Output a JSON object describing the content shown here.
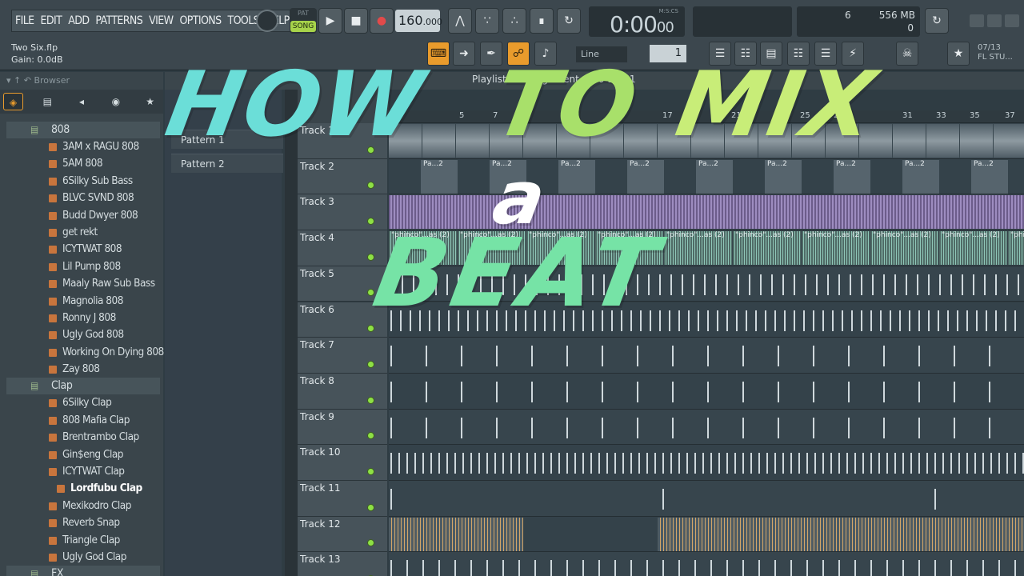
{
  "menu": [
    "FILE",
    "EDIT",
    "ADD",
    "PATTERNS",
    "VIEW",
    "OPTIONS",
    "TOOLS",
    "HELP"
  ],
  "transport": {
    "pat_label": "PAT",
    "song_label": "SONG",
    "tempo_int": "160",
    "tempo_dec": ".000",
    "time_main": "0:00",
    "time_small": "00",
    "time_label": "M:S:CS"
  },
  "cpu": {
    "cpu": "6",
    "memory": "556 MB",
    "polyphony": "0"
  },
  "hint": {
    "file": "Two Six.flp",
    "gain": "Gain:  0.0dB"
  },
  "toolbar": {
    "snap": "Line",
    "pattern_num": "1",
    "news_date": "07/13",
    "news_text": "FL STU..."
  },
  "browser": {
    "header": "Browser",
    "tabs": [
      "all-icon",
      "folder-icon",
      "speaker-icon",
      "globe-icon",
      "star-icon"
    ],
    "folders": [
      {
        "name": "808",
        "items": [
          "3AM x RAGU 808",
          "5AM 808",
          "6Silky Sub Bass",
          "BLVC SVND 808",
          "Budd Dwyer 808",
          "get rekt",
          "ICYTWAT 808",
          "Lil Pump 808",
          "Maaly Raw Sub Bass",
          "Magnolia 808",
          "Ronny J 808",
          "Ugly God 808",
          "Working On Dying 808",
          "Zay 808"
        ]
      },
      {
        "name": "Clap",
        "items": [
          "6Silky Clap",
          "808 Mafia Clap",
          "Brentrambo Clap",
          "Gin$eng Clap",
          "ICYTWAT Clap",
          "Lordfubu Clap",
          "Mexikodro Clap",
          "Reverb Snap",
          "Triangle Clap",
          "Ugly God Clap"
        ]
      },
      {
        "name": "FX",
        "items": []
      }
    ],
    "selected": "Lordfubu Clap"
  },
  "patterns": [
    "Pattern 1",
    "Pattern 2"
  ],
  "playlist": {
    "title": "Playlist - Arrangement › ...0-54-51",
    "bars": [
      "1",
      "5",
      "7",
      "11",
      "17",
      "21",
      "25",
      "27",
      "31",
      "33",
      "35",
      "37"
    ],
    "tracks": [
      "Track 1",
      "Track 2",
      "Track 3",
      "Track 4",
      "Track 5",
      "Track 6",
      "Track 7",
      "Track 8",
      "Track 9",
      "Track 10",
      "Track 11",
      "Track 12",
      "Track 13"
    ],
    "clip_label_pattern": "Pa...2",
    "clip_label_audio": "\"phinco\"...as (2)"
  },
  "overlay": {
    "how": "HOW",
    "to": "TO",
    "mix": "MIX",
    "a": "a",
    "beat": "BEAT"
  },
  "colors": {
    "accent": "#e99b2c",
    "song_green": "#a7d34a",
    "track_led": "#8ee045",
    "title_cyan": "#6bded8",
    "title_green": "#a8e06a",
    "title_mint": "#76e3a6"
  }
}
